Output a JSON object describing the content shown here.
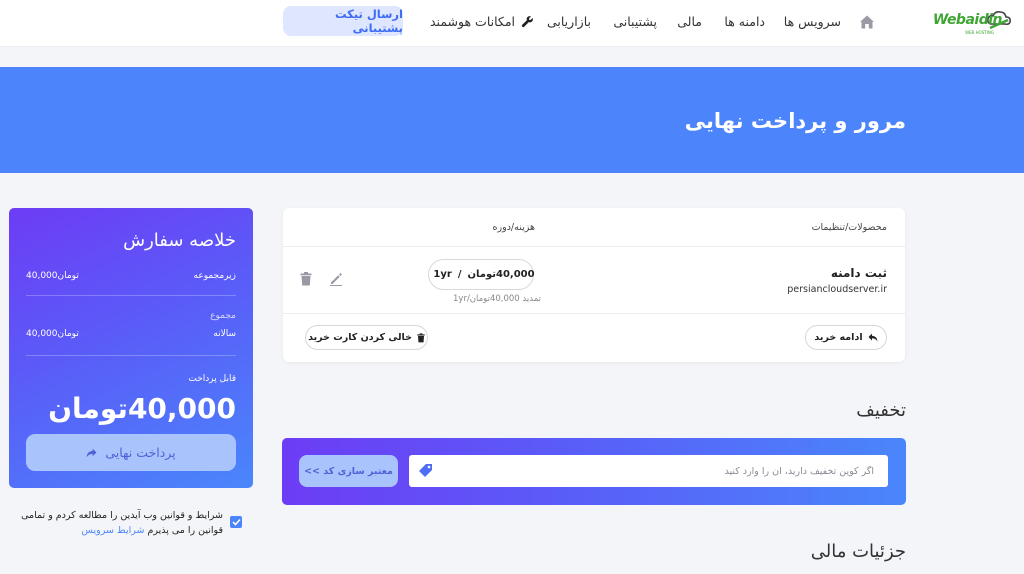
{
  "nav": {
    "logo_text": "Webaidin",
    "logo_sub": "WEB HOSTING",
    "items": [
      "سرویس ها",
      "دامنه ها",
      "مالی",
      "پشتیبانی",
      "بازاریابی",
      "امکانات هوشمند"
    ],
    "ticket_button": "ارسال تیکت پشتیبانی"
  },
  "hero": {
    "title": "مرور و پرداخت نهایی"
  },
  "cart": {
    "header_products": "محصولات/تنظیمات",
    "header_price": "هزینه/دوره",
    "item": {
      "name": "ثبت دامنه",
      "domain": "persiancloudserver.ir",
      "price": "40,000تومان",
      "period": "1yr",
      "renewal": "تمدید 40,000تومان/1yr"
    },
    "continue_label": "ادامه خرید",
    "empty_label": "خالی کردن کارت خرید"
  },
  "summary": {
    "title": "خلاصه سفارش",
    "subtotal_label": "زیرمجموعه",
    "subtotal_value": "40,000تومان",
    "totals_label": "مجموع",
    "annual_label": "سالانه",
    "annual_value": "40,000تومان",
    "payable_label": "قابل پرداخت",
    "payable_value": "40,000تومان",
    "pay_button": "پرداخت نهایی"
  },
  "terms": {
    "checked": true,
    "text": "شرایط و قوانین وب آیدین را مطالعه کردم و تمامی قوانین را می پذیرم",
    "link": "شرایط سرویس"
  },
  "discount": {
    "title": "تخفیف",
    "placeholder": "اگر کوپن تخفیف دارید، آن را وارد کنید",
    "validate_button": "معتبر سازی کد >>"
  },
  "finance": {
    "title": "جزئیات مالی"
  },
  "colors": {
    "primary": "#4c84fb",
    "gradient_start": "#6d3cf5",
    "logo_green": "#3fa535"
  }
}
